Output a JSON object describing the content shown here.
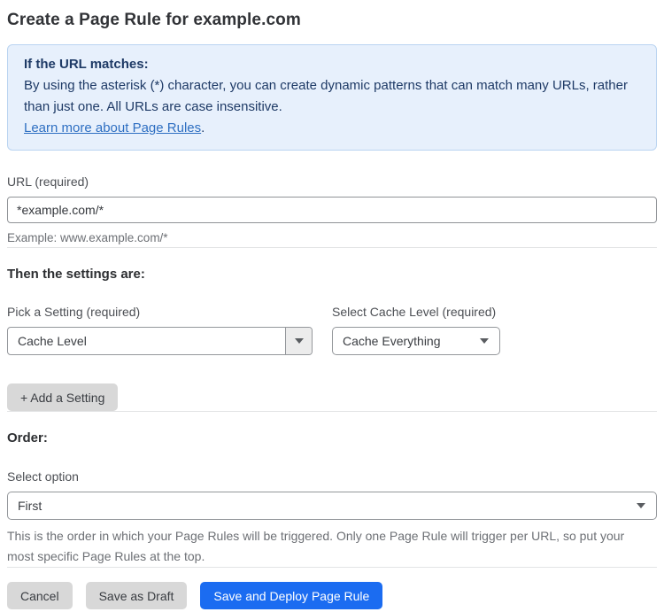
{
  "page": {
    "title": "Create a Page Rule for example.com"
  },
  "info_box": {
    "heading": "If the URL matches:",
    "body": "By using the asterisk (*) character, you can create dynamic patterns that can match many URLs, rather than just one. All URLs are case insensitive.",
    "link_label": "Learn more about Page Rules",
    "link_suffix": "."
  },
  "url_field": {
    "label": "URL (required)",
    "value": "*example.com/*",
    "helper": "Example: www.example.com/*"
  },
  "settings_section": {
    "heading": "Then the settings are:",
    "setting_picker": {
      "label": "Pick a Setting (required)",
      "value": "Cache Level"
    },
    "cache_level_picker": {
      "label": "Select Cache Level (required)",
      "value": "Cache Everything"
    },
    "add_setting_button": "+ Add a Setting"
  },
  "order_section": {
    "heading": "Order:",
    "label": "Select option",
    "value": "First",
    "helper": "This is the order in which your Page Rules will be triggered. Only one Page Rule will trigger per URL, so put your most specific Page Rules at the top."
  },
  "footer": {
    "cancel_label": "Cancel",
    "save_draft_label": "Save as Draft",
    "save_deploy_label": "Save and Deploy Page Rule"
  },
  "colors": {
    "accent_blue": "#1b6cf1",
    "info_background": "#e7f0fc",
    "info_border": "#bad4f1",
    "info_text": "#1e3a66",
    "link_blue": "#2e6fc2"
  }
}
